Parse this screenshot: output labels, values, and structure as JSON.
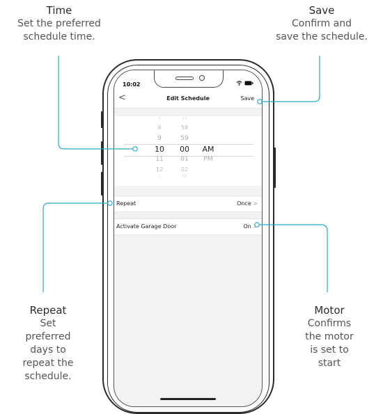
{
  "callouts": {
    "time": {
      "title": "Time",
      "desc": [
        "Set the preferred",
        "schedule time."
      ]
    },
    "save": {
      "title": "Save",
      "desc": [
        "Confirm and",
        "save the schedule."
      ]
    },
    "repeat": {
      "title": "Repeat",
      "desc": [
        "Set",
        "preferred",
        "days to",
        "repeat the",
        "schedule."
      ]
    },
    "motor": {
      "title": "Motor",
      "desc": [
        "Confirms",
        "the motor",
        "is set to",
        "start"
      ]
    }
  },
  "phone": {
    "status_time": "10:02",
    "nav": {
      "back": "<",
      "title": "Edit Schedule",
      "save": "Save"
    },
    "picker": {
      "hours": [
        "7",
        "8",
        "9",
        "10",
        "11",
        "12",
        "1"
      ],
      "minutes": [
        "57",
        "58",
        "59",
        "00",
        "01",
        "02",
        "03"
      ],
      "periods": [
        "AM",
        "PM"
      ],
      "selected_index": 3
    },
    "rows": {
      "repeat": {
        "label": "Repeat",
        "value": "Once",
        "chevron": ">"
      },
      "activate": {
        "label": "Activate Garage Door",
        "value": "On",
        "chevron": ">"
      }
    }
  },
  "colors": {
    "accent_line": "#29a8cf",
    "text": "#2b2b2b",
    "phone_outline": "#2a2a2a"
  },
  "icons": [
    "wifi-icon",
    "battery-icon",
    "back-chevron-icon",
    "chevron-right-icon"
  ]
}
